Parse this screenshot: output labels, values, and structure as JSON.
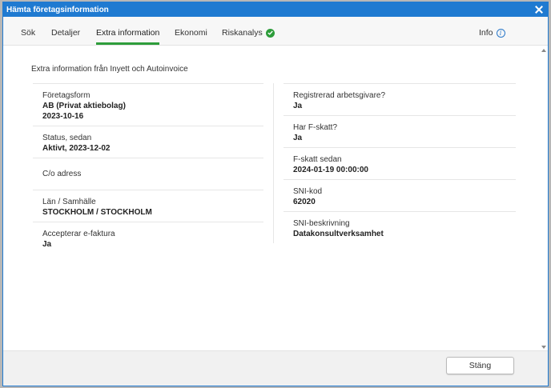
{
  "dialog": {
    "title": "Hämta företagsinformation"
  },
  "tabs": [
    {
      "label": "Sök"
    },
    {
      "label": "Detaljer"
    },
    {
      "label": "Extra information",
      "active": true
    },
    {
      "label": "Ekonomi"
    },
    {
      "label": "Riskanalys",
      "icon": "check-circle-icon"
    },
    {
      "label": "Info",
      "icon": "info-circle-icon"
    }
  ],
  "content": {
    "intro": "Extra information från Inyett och Autoinvoice",
    "left": [
      {
        "label": "Företagsform",
        "values": [
          "AB (Privat aktiebolag)",
          "2023-10-16"
        ]
      },
      {
        "label": "Status, sedan",
        "values": [
          "Aktivt, 2023-12-02"
        ]
      },
      {
        "label": "C/o adress",
        "values": []
      },
      {
        "label": "Län / Samhälle",
        "values": [
          "STOCKHOLM / STOCKHOLM"
        ]
      },
      {
        "label": "Accepterar e-faktura",
        "values": [
          "Ja"
        ]
      }
    ],
    "right": [
      {
        "label": "Registrerad arbetsgivare?",
        "values": [
          "Ja"
        ]
      },
      {
        "label": "Har F-skatt?",
        "values": [
          "Ja"
        ]
      },
      {
        "label": "F-skatt sedan",
        "values": [
          "2024-01-19 00:00:00"
        ]
      },
      {
        "label": "SNI-kod",
        "values": [
          "62020"
        ]
      },
      {
        "label": "SNI-beskrivning",
        "values": [
          "Datakonsultverksamhet"
        ]
      }
    ]
  },
  "footer": {
    "close_label": "Stäng"
  },
  "colors": {
    "titlebar": "#1f7ad1",
    "accent_green": "#2e9d3b",
    "info_blue": "#2a78c9"
  }
}
